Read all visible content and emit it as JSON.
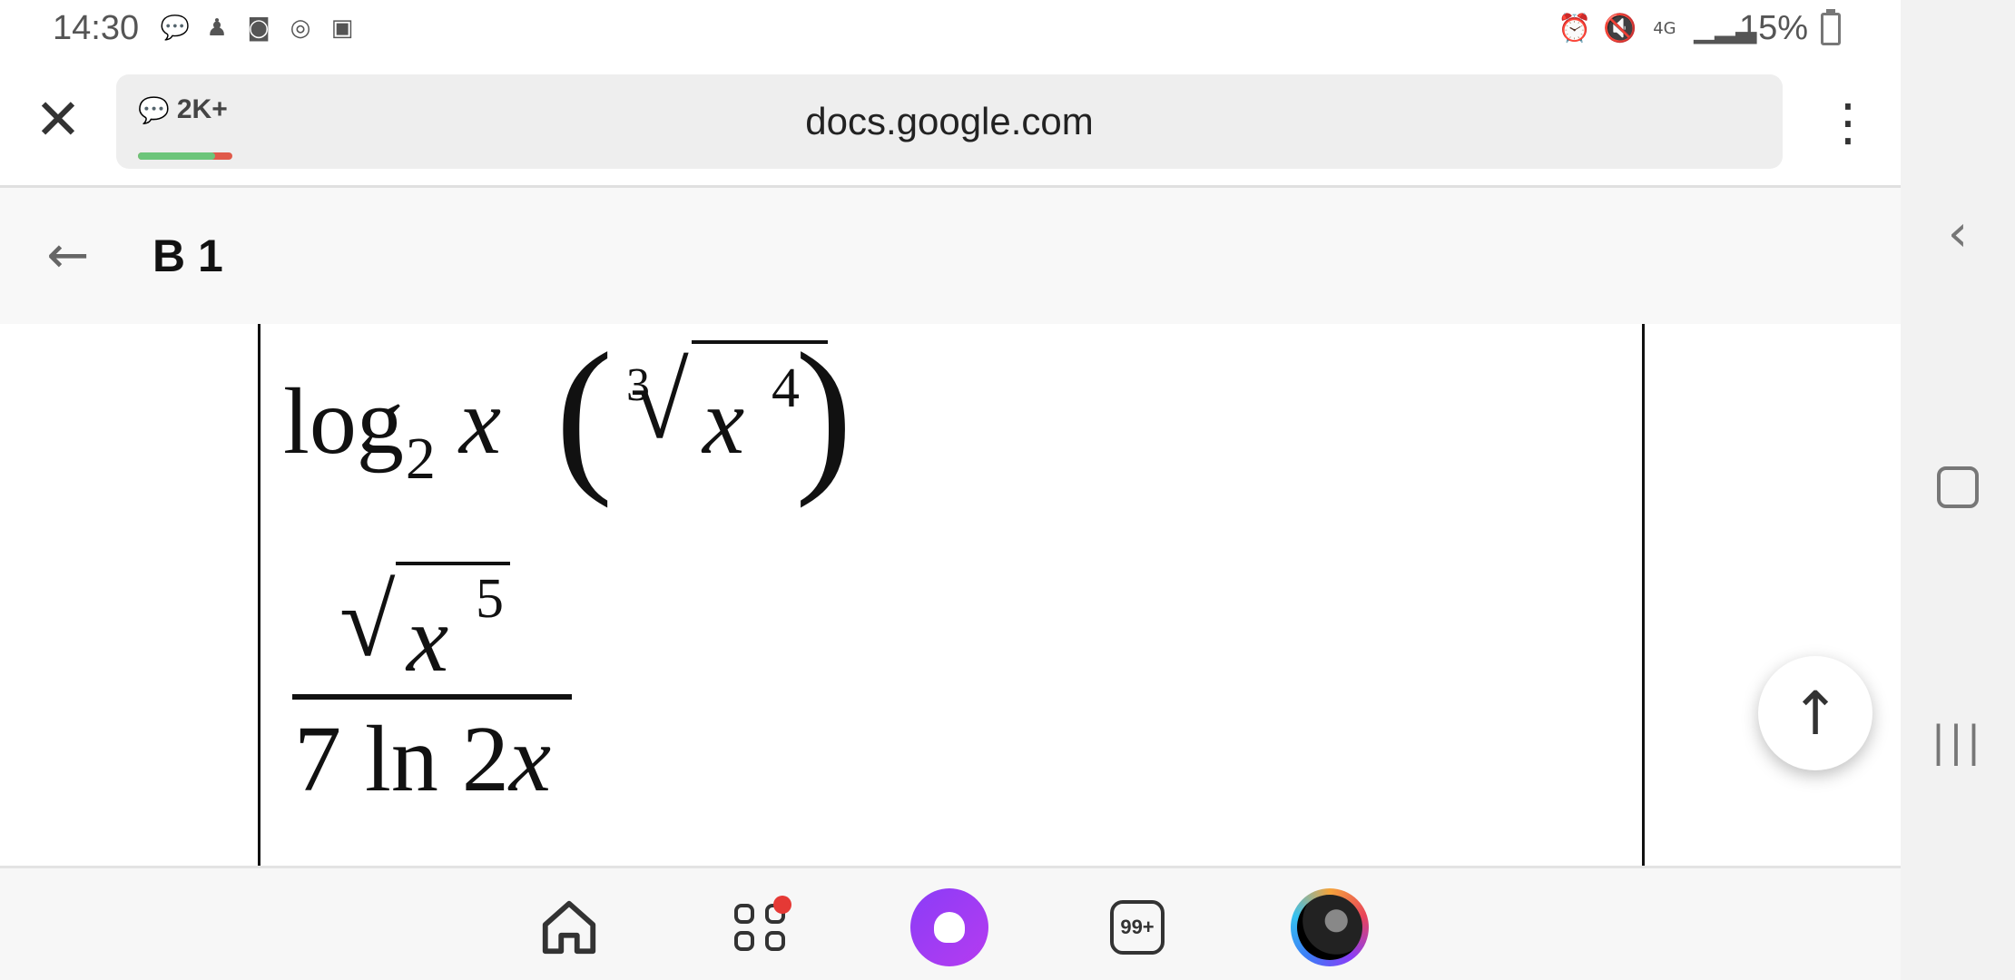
{
  "status_bar": {
    "time": "14:30",
    "left_icons": [
      "chat-bubble-icon",
      "figure-icon",
      "clock-app-icon",
      "swirl-icon",
      "image-icon"
    ],
    "right_icons": [
      "alarm-icon",
      "mute-icon",
      "4g-icon",
      "signal-icon"
    ],
    "battery": "15%",
    "network_label": "4G"
  },
  "browser": {
    "close_symbol": "✕",
    "comments_count": "2K+",
    "comments_progress": 0.82,
    "url": "docs.google.com",
    "menu_symbol": "⋮"
  },
  "document": {
    "back_symbol": "←",
    "title": "B 1",
    "math": {
      "line1_func": "log",
      "line1_sub": "2",
      "line1_var": "x",
      "paren_open": "(",
      "paren_close": ")",
      "root_index": "3",
      "radical": "√",
      "radicand": "x",
      "radicand_exp": "4",
      "frac_num_var": "x",
      "frac_num_exp": "5",
      "frac_den_prefix": "7 ln 2",
      "frac_den_var": "x"
    }
  },
  "scroll_top_symbol": "↑",
  "bottom_nav": {
    "tabs_count": "99+",
    "apps_notification": true
  },
  "system_nav": {
    "back": "‹",
    "recent": "|||"
  },
  "colors": {
    "url_box_bg": "#eeeeee",
    "progress_green": "#6cc57a",
    "progress_red": "#e05a4a",
    "assistant_purple": "#8b3df7",
    "notification_red": "#e53935"
  }
}
